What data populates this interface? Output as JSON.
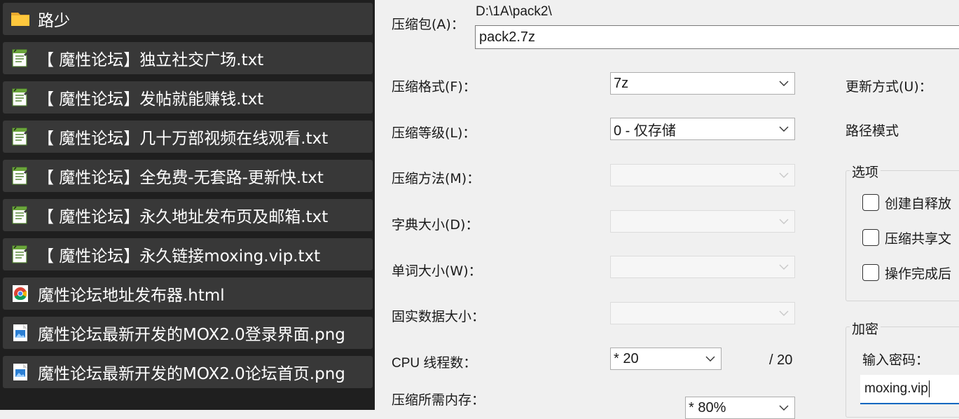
{
  "files": [
    {
      "name": "路少",
      "icon": "folder-icon"
    },
    {
      "name": "【 魔性论坛】独立社交广场.txt",
      "icon": "txt-icon"
    },
    {
      "name": "【 魔性论坛】发帖就能赚钱.txt",
      "icon": "txt-icon"
    },
    {
      "name": "【 魔性论坛】几十万部视频在线观看.txt",
      "icon": "txt-icon"
    },
    {
      "name": "【 魔性论坛】全免费-无套路-更新快.txt",
      "icon": "txt-icon"
    },
    {
      "name": "【 魔性论坛】永久地址发布页及邮箱.txt",
      "icon": "txt-icon"
    },
    {
      "name": "【 魔性论坛】永久链接moxing.vip.txt",
      "icon": "txt-icon"
    },
    {
      "name": "魔性论坛地址发布器.html",
      "icon": "chrome-icon"
    },
    {
      "name": "魔性论坛最新开发的MOX2.0登录界面.png",
      "icon": "png-icon"
    },
    {
      "name": "魔性论坛最新开发的MOX2.0论坛首页.png",
      "icon": "png-icon"
    }
  ],
  "dialog": {
    "archive_label": "压缩包(A)：",
    "archive_path": "D:\\1A\\pack2\\",
    "archive_name": "pack2.7z",
    "format_label": "压缩格式(F)：",
    "format_value": "7z",
    "level_label": "压缩等级(L)：",
    "level_value": "0 - 仅存储",
    "method_label": "压缩方法(M)：",
    "dict_label": "字典大小(D)：",
    "word_label": "单词大小(W)：",
    "solid_label": "固实数据大小：",
    "cpu_label": "CPU 线程数：",
    "cpu_value": "*  20",
    "cpu_max": "/ 20",
    "mem_label": "压缩所需内存：",
    "mem_value": "*  80%",
    "update_label": "更新方式(U)：",
    "path_mode_label": "路径模式",
    "options_title": "选项",
    "options": [
      {
        "label": "创建自释放",
        "checked": false
      },
      {
        "label": "压缩共享文",
        "checked": false
      },
      {
        "label": "操作完成后",
        "checked": false
      }
    ],
    "encrypt_title": "加密",
    "password_label": "输入密码：",
    "password_value": "moxing.vip"
  }
}
